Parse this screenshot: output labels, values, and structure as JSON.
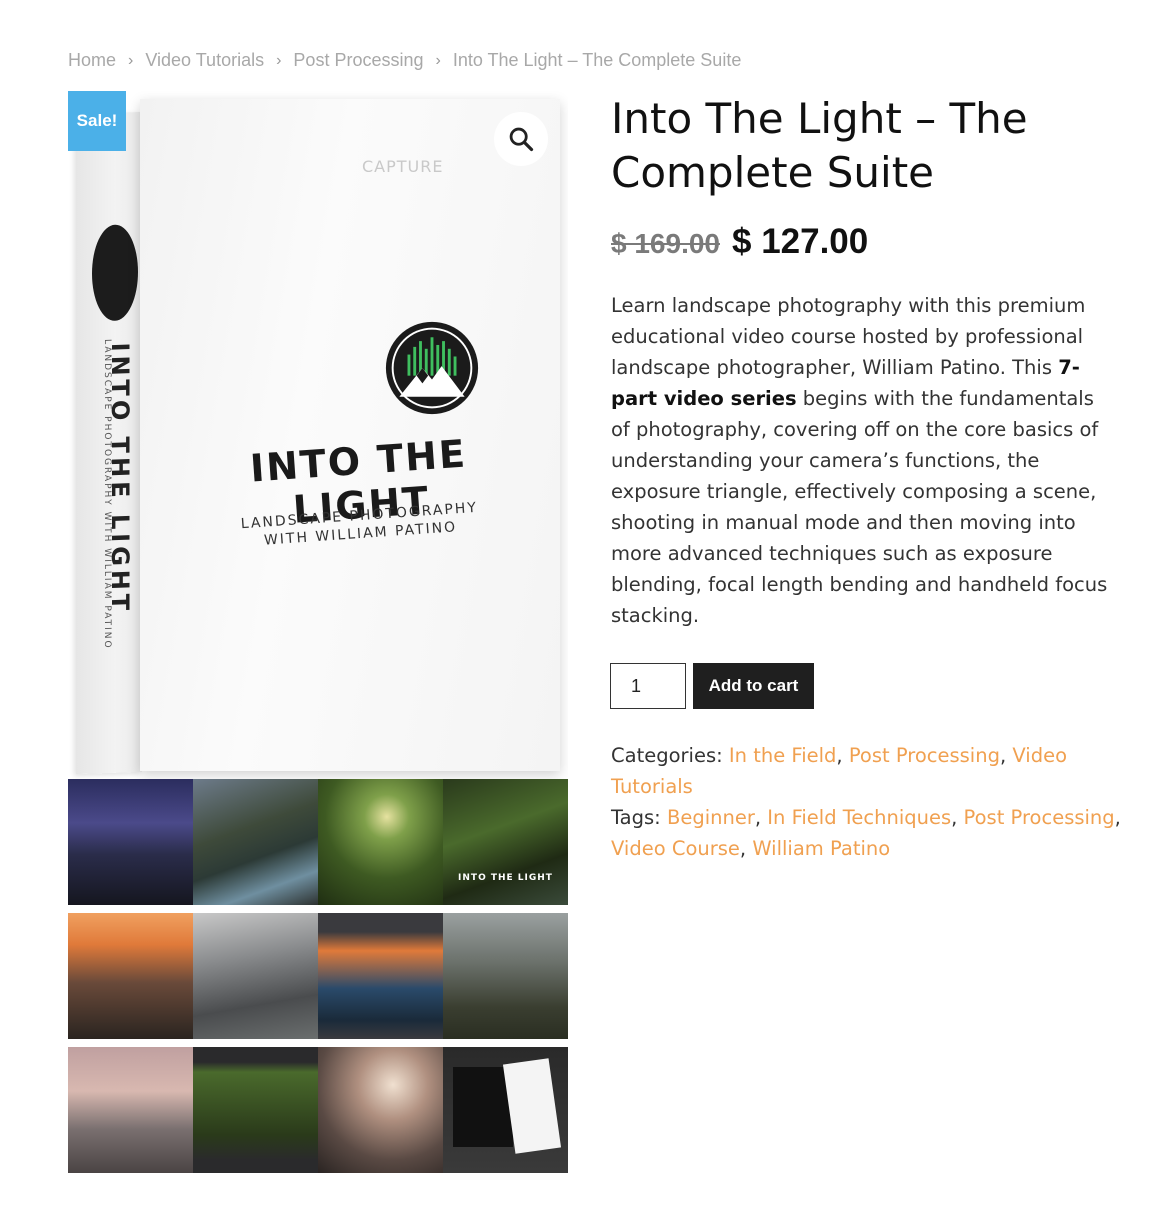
{
  "breadcrumb": {
    "items": [
      "Home",
      "Video Tutorials",
      "Post Processing"
    ],
    "current": "Into The Light – The Complete Suite",
    "separator": "›"
  },
  "gallery": {
    "sale_badge": "Sale!",
    "zoom_icon": "magnifier-icon",
    "box": {
      "brand": "CAPTURE",
      "title": "INTO THE LIGHT",
      "subtitle_line1": "LANDSCAPE PHOTOGRAPHY",
      "subtitle_line2": "WITH WILLIAM PATINO",
      "side_title": "INTO THE LIGHT",
      "side_subtitle": "LANDSCAPE PHOTOGRAPHY WITH WILLIAM PATINO"
    },
    "thumb_overlay_title": "INTO THE LIGHT"
  },
  "product": {
    "title": "Into The Light – The Complete Suite",
    "price_old": "$ 169.00",
    "price_new": "$ 127.00",
    "description_before": "Learn landscape photography with this premium educational video course hosted by professional landscape photographer, William Patino. This ",
    "description_bold": "7-part video series",
    "description_after": " begins with the fundamentals of photography, covering off on the core basics of understanding your camera’s functions, the exposure triangle, effectively composing a scene, shooting in manual mode and then moving into more advanced techniques such as exposure blending, focal length bending and handheld focus stacking.",
    "quantity": "1",
    "add_to_cart": "Add to cart"
  },
  "meta": {
    "categories_label": "Categories:",
    "categories": [
      "In the Field",
      "Post Processing",
      "Video Tutorials"
    ],
    "tags_label": "Tags:",
    "tags": [
      "Beginner",
      "In Field Techniques",
      "Post Processing",
      "Video Course",
      "William Patino"
    ]
  },
  "colors": {
    "sale_badge": "#4bb0e8",
    "link": "#f0a050",
    "button": "#1f1f1f"
  }
}
